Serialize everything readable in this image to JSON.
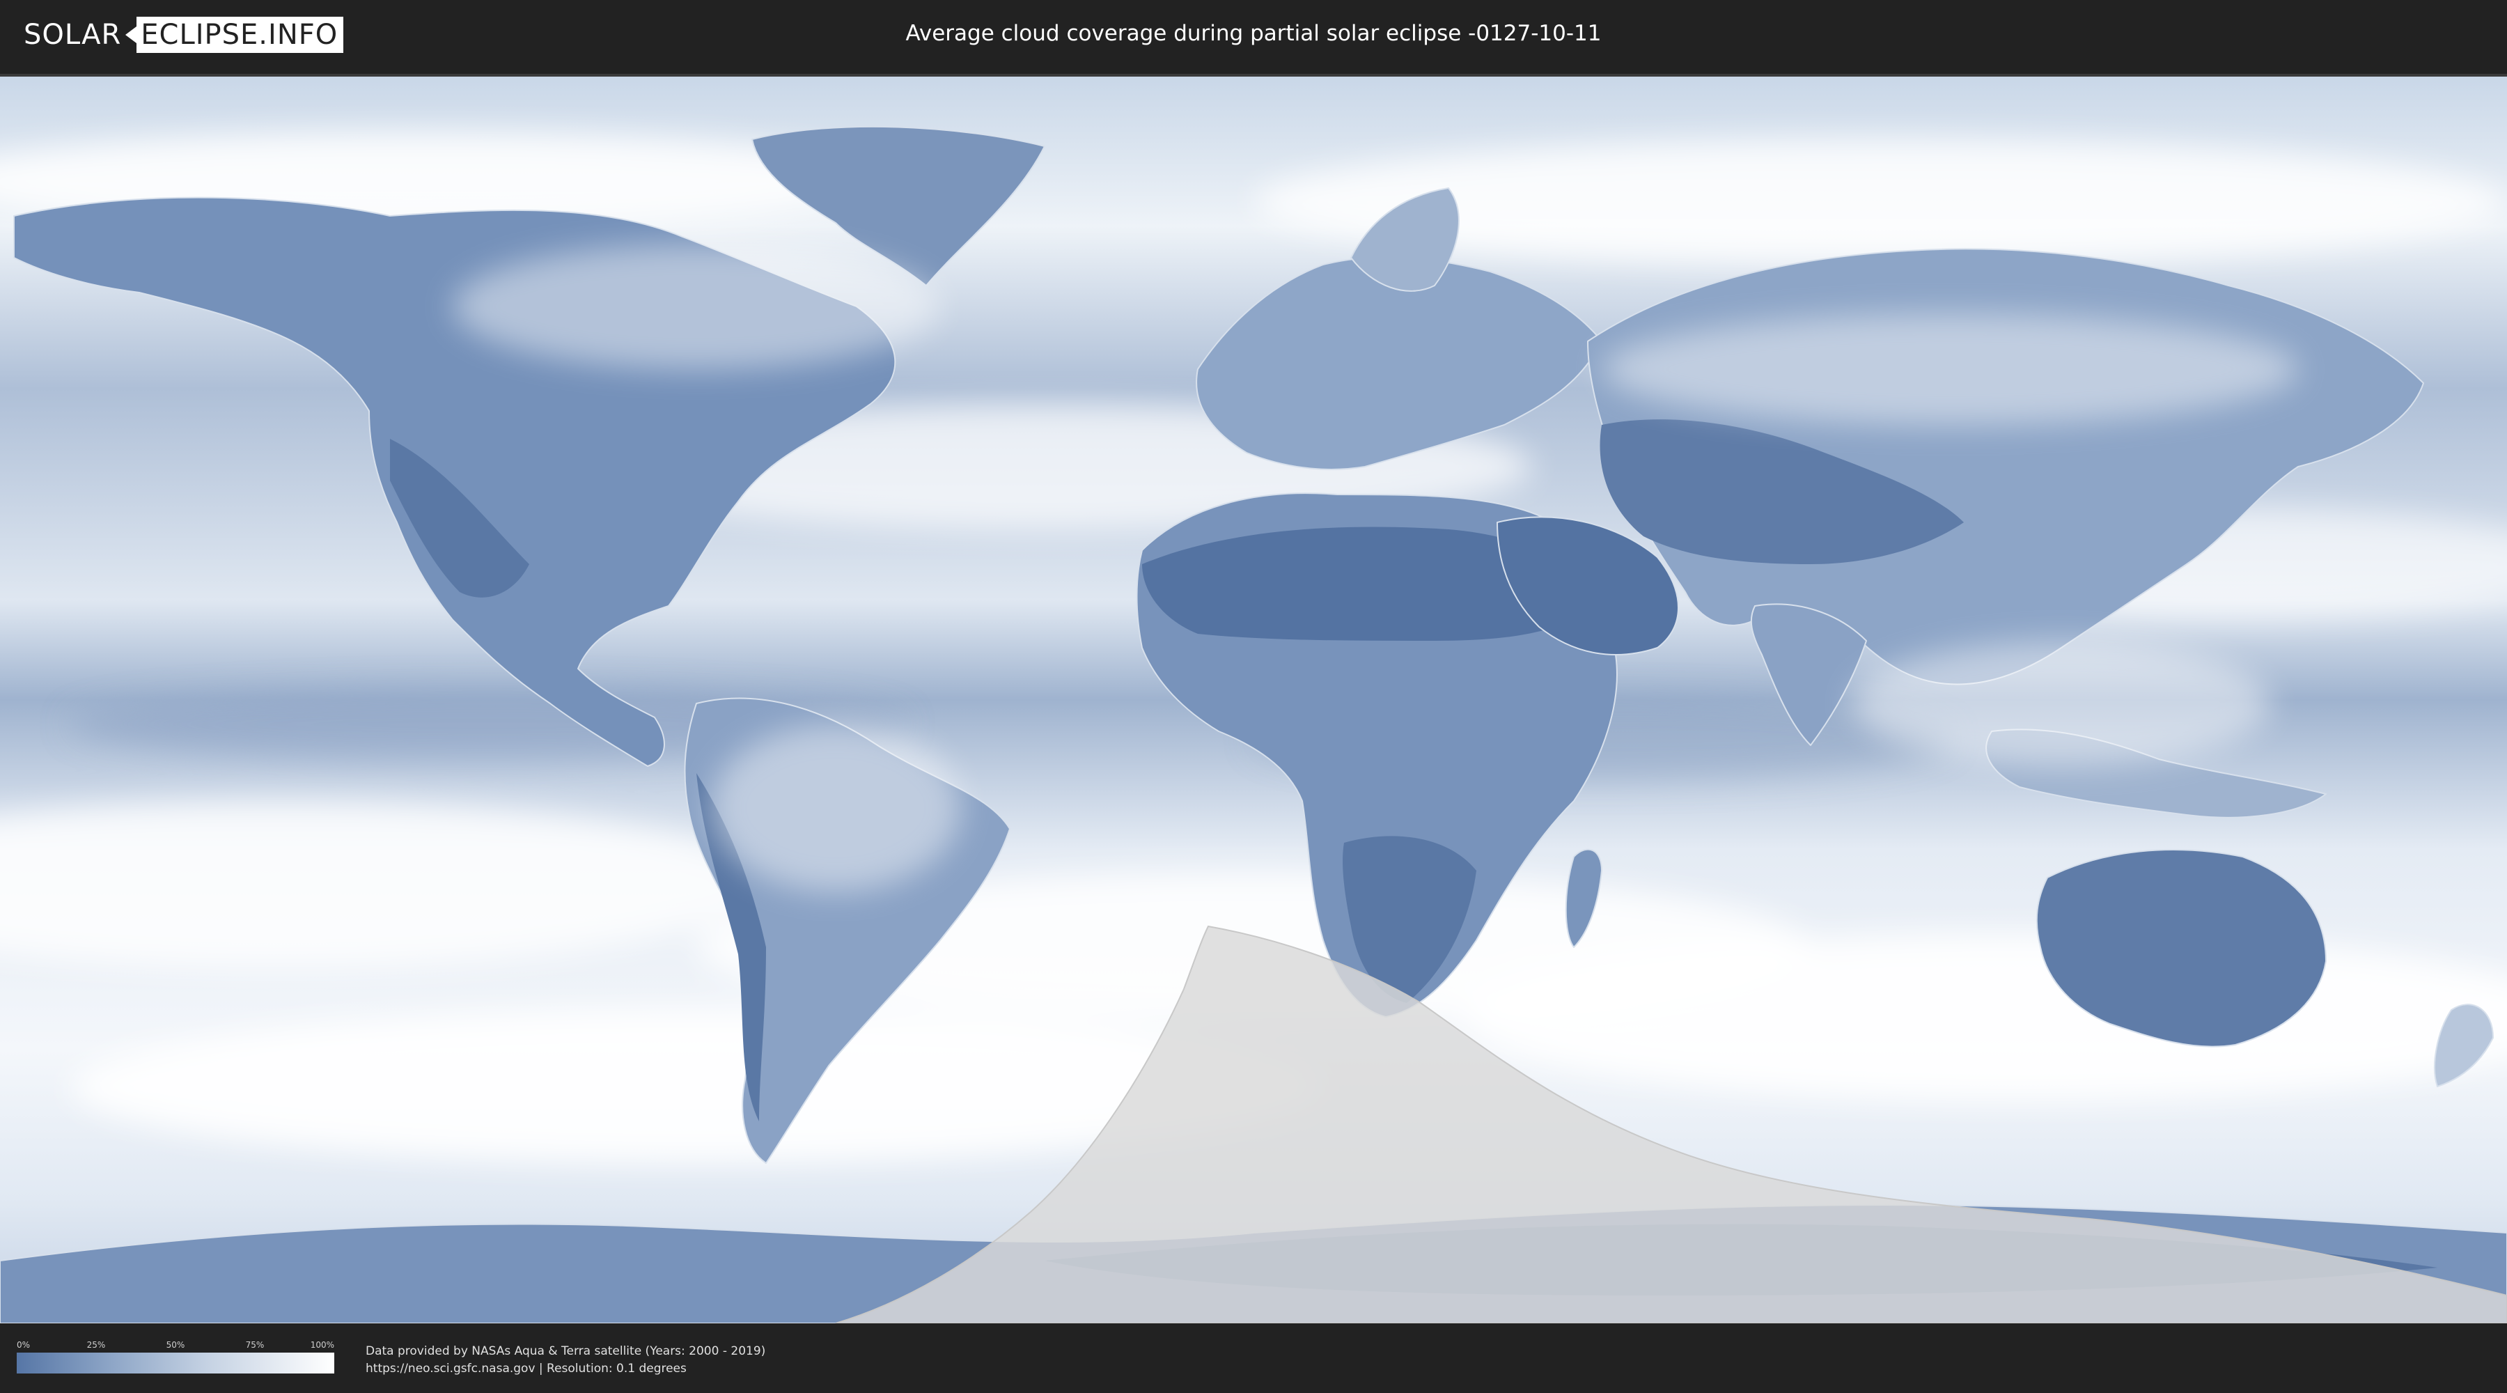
{
  "header": {
    "logo_left": "SOLAR",
    "logo_right": "ECLIPSE.INFO",
    "title": "Average cloud coverage during partial solar eclipse -0127-10-11"
  },
  "map": {
    "ocean_color": "#5f7ea8",
    "cloud_color": "#ffffff",
    "land_color": "#4f6c98",
    "eclipse_zone_color": "#d9d9d9"
  },
  "legend": {
    "ticks": [
      "0%",
      "25%",
      "50%",
      "75%",
      "100%"
    ],
    "gradient": [
      "#5676a6",
      "#ffffff"
    ]
  },
  "credits": {
    "line1": "Data provided by NASAs Aqua & Terra satellite (Years: 2000 - 2019)",
    "line2": "https://neo.sci.gsfc.nasa.gov | Resolution: 0.1 degrees"
  }
}
